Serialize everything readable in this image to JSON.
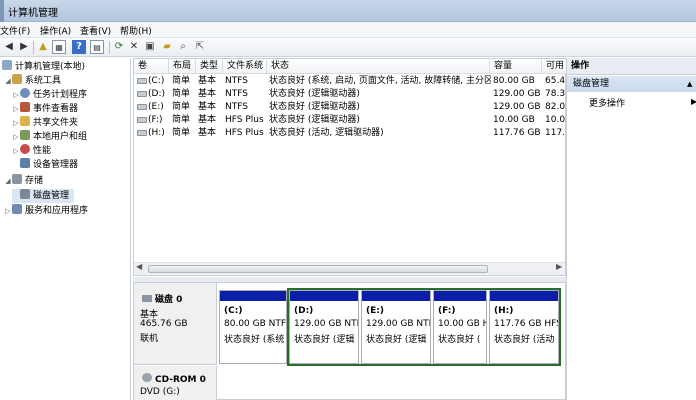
{
  "window": {
    "title": "计算机管理"
  },
  "menu": [
    "文件(F)",
    "操作(A)",
    "查看(V)",
    "帮助(H)"
  ],
  "toolbar_icons": [
    "back-icon",
    "forward-icon",
    "up-folder-icon",
    "show-hide-tree-icon",
    "help-icon",
    "view-icon",
    "refresh-icon",
    "delete-icon",
    "properties-icon",
    "open-icon",
    "search-icon",
    "export-icon"
  ],
  "tree": {
    "root": "计算机管理(本地)",
    "items": [
      {
        "label": "系统工具",
        "level": 1
      },
      {
        "label": "任务计划程序",
        "level": 2
      },
      {
        "label": "事件查看器",
        "level": 2
      },
      {
        "label": "共享文件夹",
        "level": 2
      },
      {
        "label": "本地用户和组",
        "level": 2
      },
      {
        "label": "性能",
        "level": 2
      },
      {
        "label": "设备管理器",
        "level": 2
      },
      {
        "label": "存储",
        "level": 1
      },
      {
        "label": "磁盘管理",
        "level": 2
      },
      {
        "label": "服务和应用程序",
        "level": 1
      }
    ]
  },
  "volumes": {
    "headers": [
      "卷",
      "布局",
      "类型",
      "文件系统",
      "状态",
      "容量",
      "可用"
    ],
    "rows": [
      {
        "vol": "(C:)",
        "layout": "简单",
        "type": "基本",
        "fs": "NTFS",
        "status": "状态良好 (系统, 启动, 页面文件, 活动, 故障转储, 主分区)",
        "capacity": "80.00 GB",
        "free": "65.4"
      },
      {
        "vol": "(D:)",
        "layout": "简单",
        "type": "基本",
        "fs": "NTFS",
        "status": "状态良好 (逻辑驱动器)",
        "capacity": "129.00 GB",
        "free": "78.3"
      },
      {
        "vol": "(E:)",
        "layout": "简单",
        "type": "基本",
        "fs": "NTFS",
        "status": "状态良好 (逻辑驱动器)",
        "capacity": "129.00 GB",
        "free": "82.0"
      },
      {
        "vol": "(F:)",
        "layout": "简单",
        "type": "基本",
        "fs": "HFS Plus",
        "status": "状态良好 (逻辑驱动器)",
        "capacity": "10.00 GB",
        "free": "10.0"
      },
      {
        "vol": "(H:)",
        "layout": "简单",
        "type": "基本",
        "fs": "HFS Plus",
        "status": "状态良好 (活动, 逻辑驱动器)",
        "capacity": "117.76 GB",
        "free": "117."
      }
    ]
  },
  "disk0": {
    "name": "磁盘 0",
    "type": "基本",
    "size": "465.76 GB",
    "status": "联机"
  },
  "partitions": [
    {
      "label": "(C:)",
      "size": "80.00 GB NTFS",
      "status": "状态良好 (系统"
    },
    {
      "label": "(D:)",
      "size": "129.00 GB NTF",
      "status": "状态良好 (逻辑"
    },
    {
      "label": "(E:)",
      "size": "129.00 GB NTF",
      "status": "状态良好 (逻辑"
    },
    {
      "label": "(F:)",
      "size": "10.00 GB H",
      "status": "状态良好 ("
    },
    {
      "label": "(H:)",
      "size": "117.76 GB HFS",
      "status": "状态良好 (活动"
    }
  ],
  "cdrom": {
    "name": "CD-ROM 0",
    "drive": "DVD (G:)"
  },
  "actions": {
    "header": "操作",
    "section": "磁盘管理",
    "more": "更多操作"
  },
  "colors": {
    "partition_bar": "#0a1ea8",
    "selection": "#2b6e2b",
    "titlebar": "#c9d8ea"
  }
}
